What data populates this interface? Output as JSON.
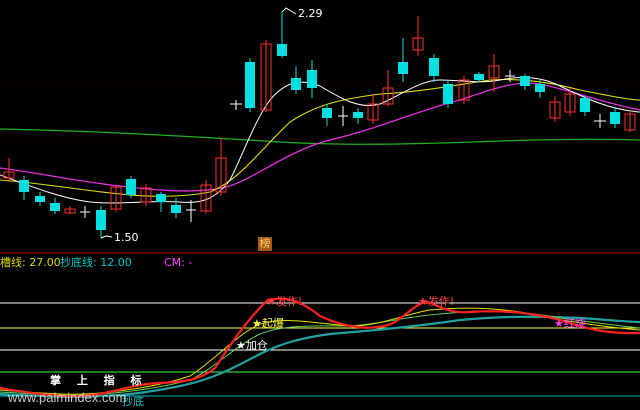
{
  "price": {
    "high_label": "2.29",
    "low_label": "1.50"
  },
  "badge": "榜",
  "indicator_header": {
    "part1": "槽线: 27.00",
    "part2": "抄底线: 12.00",
    "part3": "CM: -"
  },
  "signals": {
    "fa_zuo_1": "★发作!",
    "fa_zuo_2": "★发作!",
    "qi_bao": "★起爆",
    "jia_cang": "★加仓",
    "chao_di": "抄底",
    "right_star": "★红烧"
  },
  "watermark": {
    "title": "掌 上 指 标",
    "url": "www.palmindex.com"
  },
  "colors": {
    "background": "#000000",
    "up_candle": "#ff3030",
    "down_candle": "#00e0e0",
    "doji": "#ffffff",
    "ma_white": "#ffffff",
    "ma_yellow": "#e0e000",
    "ma_magenta": "#e030e0",
    "ma_green": "#20b020",
    "indicator_red": "#ff2020",
    "indicator_teal": "#20a0a0",
    "grid_red": "#800000"
  }
}
